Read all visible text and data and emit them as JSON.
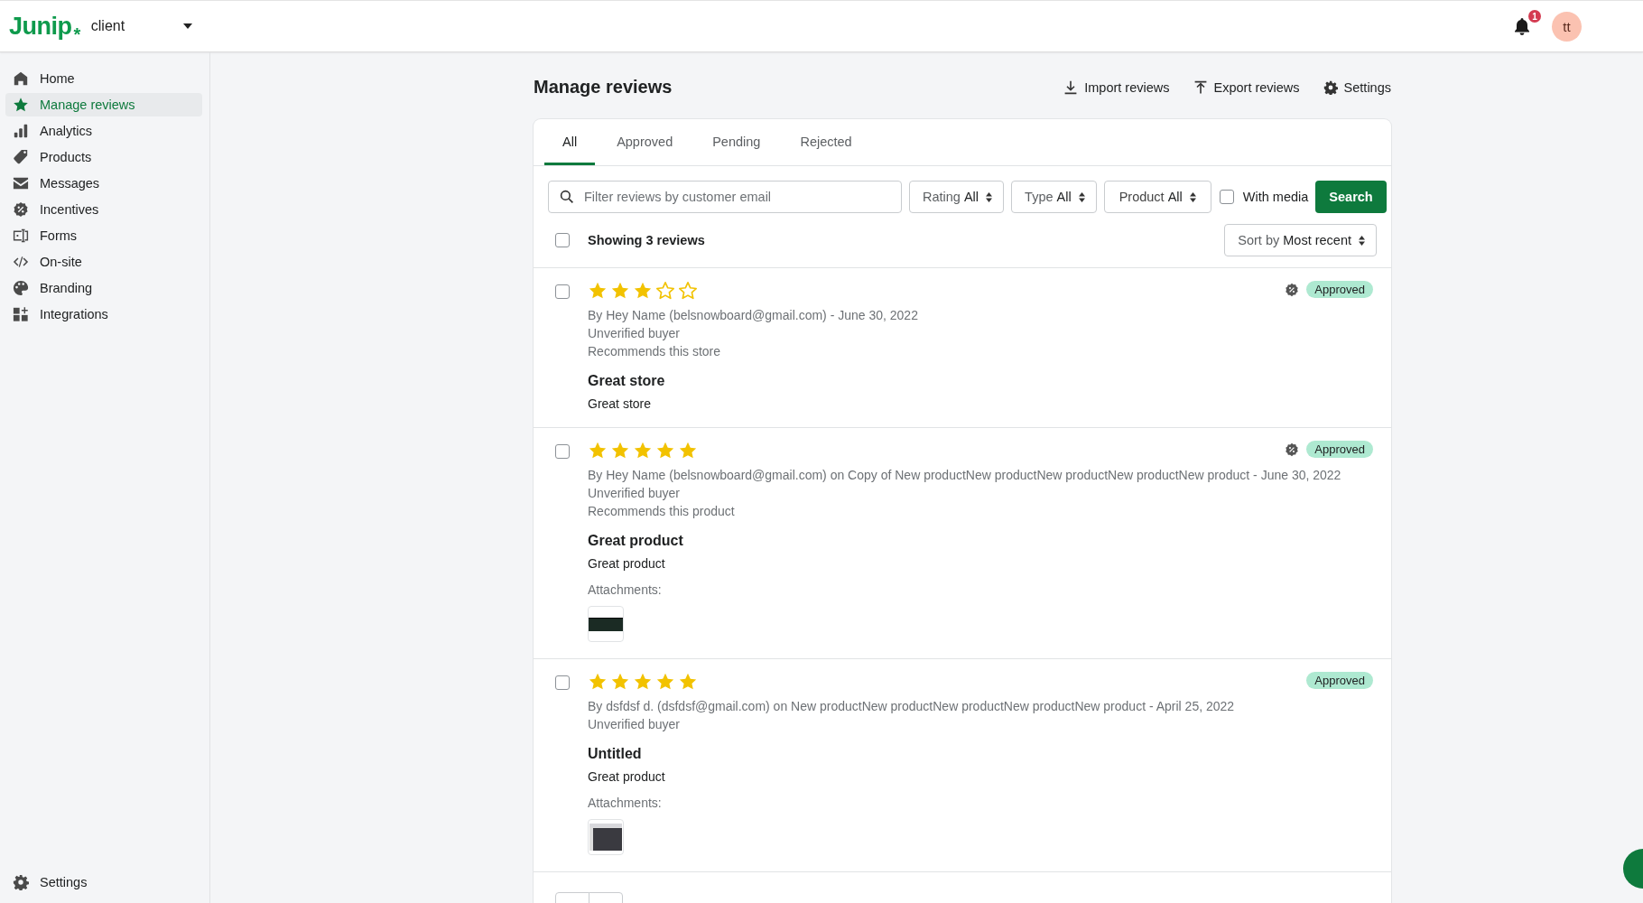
{
  "header": {
    "logo": "Junip",
    "logo_mark": "*",
    "store": "client",
    "notifications": "1",
    "avatar": "tt"
  },
  "sidebar": {
    "items": [
      {
        "label": "Home",
        "selected": false
      },
      {
        "label": "Manage reviews",
        "selected": true
      },
      {
        "label": "Analytics",
        "selected": false
      },
      {
        "label": "Products",
        "selected": false
      },
      {
        "label": "Messages",
        "selected": false
      },
      {
        "label": "Incentives",
        "selected": false
      },
      {
        "label": "Forms",
        "selected": false
      },
      {
        "label": "On-site",
        "selected": false
      },
      {
        "label": "Branding",
        "selected": false
      },
      {
        "label": "Integrations",
        "selected": false
      }
    ],
    "footer": {
      "label": "Settings",
      "selected": false
    }
  },
  "page": {
    "title": "Manage reviews",
    "actions": [
      {
        "label": "Import reviews",
        "kind": "import"
      },
      {
        "label": "Export reviews",
        "kind": "export"
      },
      {
        "label": "Settings",
        "kind": "settings"
      }
    ]
  },
  "tabs": [
    {
      "label": "All",
      "selected": true
    },
    {
      "label": "Approved",
      "selected": false
    },
    {
      "label": "Pending",
      "selected": false
    },
    {
      "label": "Rejected",
      "selected": false
    }
  ],
  "filters": {
    "search": {
      "placeholder": "Filter reviews by customer email"
    },
    "selects": [
      {
        "label": "Rating",
        "value": "All"
      },
      {
        "label": "Type",
        "value": "All"
      },
      {
        "label": "Product",
        "value": "All"
      }
    ],
    "with_media": {
      "label": "With media",
      "checked": false
    },
    "search_button": "Search"
  },
  "list_header": {
    "select_all": false,
    "count": "Showing 3 reviews",
    "sort": {
      "label": "Sort by",
      "value": "Most recent"
    }
  },
  "reviews": [
    {
      "checked": false,
      "stars": 3,
      "byline": "By Hey Name (belsnowboard@gmail.com) - June 30, 2022",
      "buyer": "Unverified buyer",
      "recommends": "Recommends this store",
      "title": "Great store",
      "body": "Great store",
      "status": "Approved",
      "icon_shown": true
    },
    {
      "checked": false,
      "stars": 5,
      "byline": "By Hey Name (belsnowboard@gmail.com) on Copy of New productNew productNew productNew productNew product - June 30, 2022",
      "buyer": "Unverified buyer",
      "recommends": "Recommends this product",
      "title": "Great product",
      "body": "Great product",
      "status": "Approved",
      "icon_shown": true,
      "attachments_label": "Attachments:",
      "attachments": [
        {
          "kind": "dark"
        }
      ]
    },
    {
      "checked": false,
      "stars": 5,
      "byline": "By dsfdsf d. (dsfdsf@gmail.com) on New productNew productNew productNew productNew product - April 25, 2022",
      "buyer": "Unverified buyer",
      "title": "Untitled",
      "body": "Great product",
      "status": "Approved",
      "icon_shown": false,
      "attachments_label": "Attachments:",
      "attachments": [
        {
          "kind": "screen"
        }
      ]
    }
  ]
}
